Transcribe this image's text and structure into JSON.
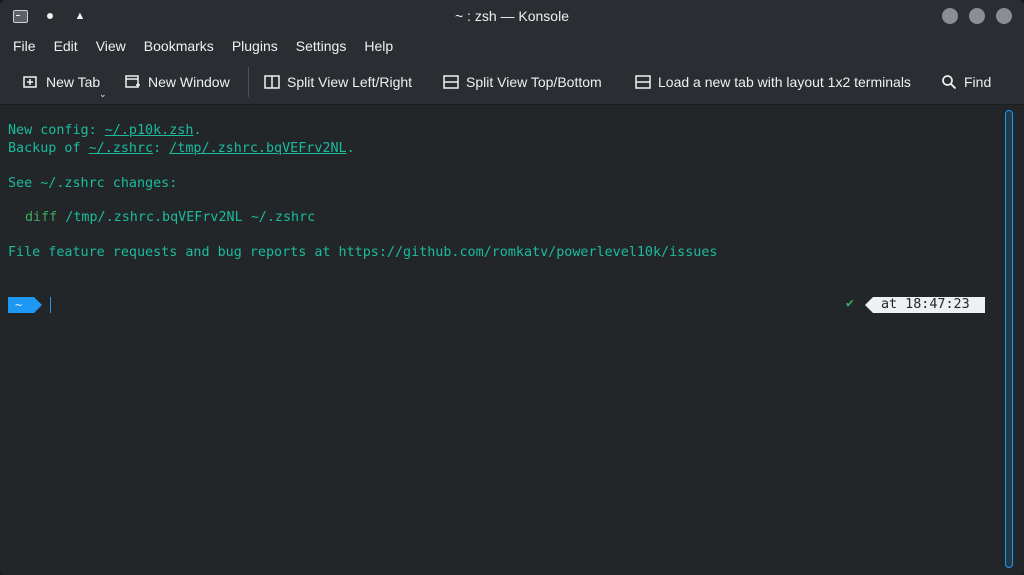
{
  "window": {
    "title": "~ : zsh — Konsole"
  },
  "titlebar_icons": [
    "terminal-app-icon",
    "pin-icon",
    "keep-above-icon",
    "minimize-icon",
    "maximize-icon",
    "close-icon"
  ],
  "menu": {
    "items": [
      "File",
      "Edit",
      "View",
      "Bookmarks",
      "Plugins",
      "Settings",
      "Help"
    ]
  },
  "toolbar": {
    "new_tab": "New Tab",
    "new_window": "New Window",
    "split_lr": "Split View Left/Right",
    "split_tb": "Split View Top/Bottom",
    "load_layout": "Load a new tab with layout 1x2 terminals",
    "find": "Find"
  },
  "terminal": {
    "line1_prefix": "New config: ",
    "line1_path": "~/.p10k.zsh",
    "line1_suffix": ".",
    "line2_prefix": "Backup of ",
    "line2_path1": "~/.zshrc",
    "line2_mid": ": ",
    "line2_path2": "/tmp/.zshrc.bqVEFrv2NL",
    "line2_suffix": ".",
    "line3": "See ~/.zshrc changes:",
    "line4_cmd": "diff",
    "line4_args": " /tmp/.zshrc.bqVEFrv2NL ~/.zshrc",
    "line5": "File feature requests and bug reports at https://github.com/romkatv/powerlevel10k/issues",
    "prompt_dir": "~",
    "status_check": "✔",
    "time": "at 18:47:23"
  },
  "colors": {
    "accent": "#1d99f3",
    "terminal_text": "#1abc9c",
    "ok_green": "#3daa5d",
    "background": "#232629"
  }
}
